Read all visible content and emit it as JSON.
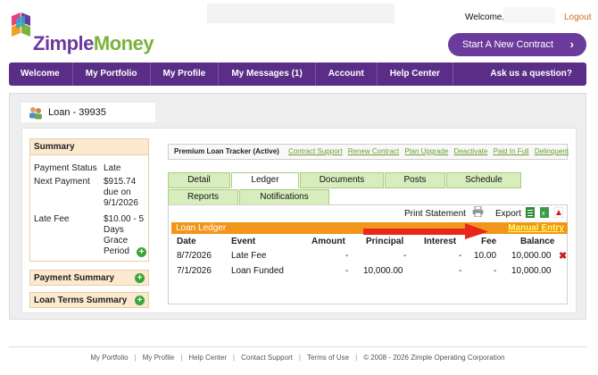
{
  "header": {
    "brand": {
      "prefix": "Zimple",
      "suffix": "Money"
    },
    "welcome": "Welcome,",
    "logout": "Logout",
    "start_button": "Start A New Contract"
  },
  "nav": {
    "items": [
      "Welcome",
      "My Portfolio",
      "My Profile",
      "My Messages (1)",
      "Account",
      "Help Center"
    ],
    "ask": "Ask us a question?"
  },
  "loan": {
    "title": "Loan - 39935"
  },
  "summary": {
    "title": "Summary",
    "rows": [
      {
        "label": "Payment Status",
        "value": [
          "Late"
        ]
      },
      {
        "label": "Next Payment",
        "value": [
          "$915.74",
          "due on",
          "9/1/2026"
        ]
      },
      {
        "label": "Late Fee",
        "value": [
          "$10.00 - 5",
          "Days Grace",
          "Period"
        ]
      }
    ]
  },
  "sections": {
    "payment_summary": "Payment Summary",
    "loan_terms_summary": "Loan Terms Summary"
  },
  "tracker": {
    "title": "Premium Loan Tracker (Active)",
    "links": [
      "Contract Support",
      "Renew Contract",
      "Plan Upgrade",
      "Deactivate",
      "Paid In Full",
      "Delinquent"
    ]
  },
  "tabs": {
    "row1": [
      "Detail",
      "Ledger",
      "Documents",
      "Posts",
      "Schedule"
    ],
    "row2": [
      "Reports",
      "Notifications"
    ],
    "active": "Ledger"
  },
  "ledger": {
    "print_statement": "Print Statement",
    "export": "Export",
    "title": "Loan Ledger",
    "manual_entry": "Manual Entry",
    "columns": [
      "Date",
      "Event",
      "Amount",
      "Principal",
      "Interest",
      "Fee",
      "Balance"
    ],
    "rows": [
      [
        "8/7/2026",
        "Late Fee",
        "-",
        "-",
        "-",
        "10.00",
        "10,000.00"
      ],
      [
        "7/1/2026",
        "Loan Funded",
        "-",
        "10,000.00",
        "-",
        "-",
        "10,000.00"
      ]
    ]
  },
  "footer": {
    "links": [
      "My Portfolio",
      "My Profile",
      "Help Center",
      "Contact Support",
      "Terms of Use"
    ],
    "copyright": "© 2008 - 2026 Zimple Operating Corporation"
  },
  "colors": {
    "brand_purple": "#6a3b9c",
    "nav_purple": "#5a2d86",
    "brand_green": "#7ab33d",
    "ledger_orange": "#f3941b",
    "tab_green": "#d8edbd",
    "summary_peach": "#fde9cf",
    "arrow_red": "#e8261c"
  }
}
